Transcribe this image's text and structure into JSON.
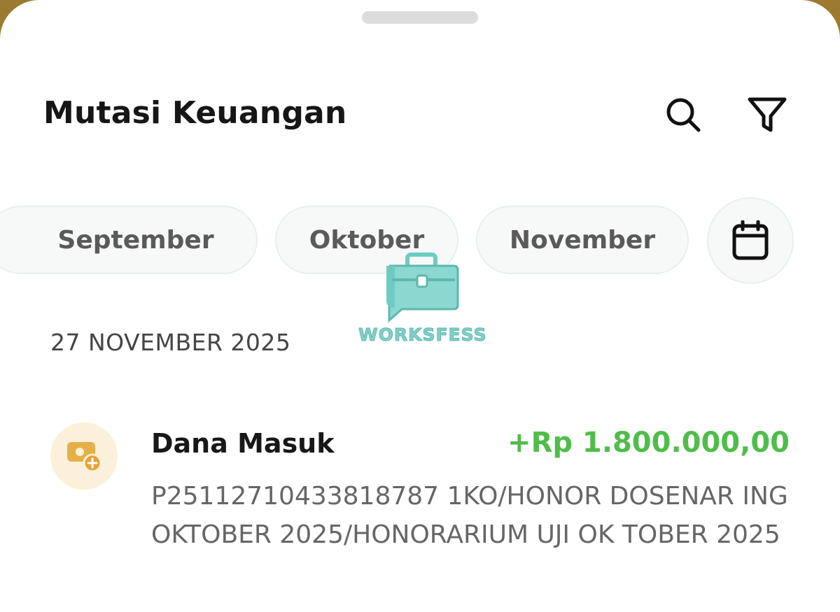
{
  "header": {
    "title": "Mutasi Keuangan",
    "search_icon": "search-icon",
    "filter_icon": "filter-icon"
  },
  "month_filter": {
    "chips": [
      {
        "label": "September"
      },
      {
        "label": "Oktober"
      },
      {
        "label": "November"
      }
    ],
    "calendar_icon": "calendar-icon"
  },
  "watermark": {
    "text": "WORKSFESS"
  },
  "transactions": {
    "date_header": "27 NOVEMBER 2025",
    "items": [
      {
        "title": "Dana Masuk",
        "amount": "+Rp 1.800.000,00",
        "description": "P25112710433818787 1KO/HONOR DOSENAR ING OKTOBER 2025/HONORARIUM UJI OK TOBER 2025",
        "icon": "wallet-add-icon"
      }
    ]
  },
  "colors": {
    "accent_green": "#4fbd4a",
    "chip_bg": "#f7f8f8",
    "avatar_bg": "#fbf0d9",
    "avatar_icon": "#e5b04a"
  }
}
